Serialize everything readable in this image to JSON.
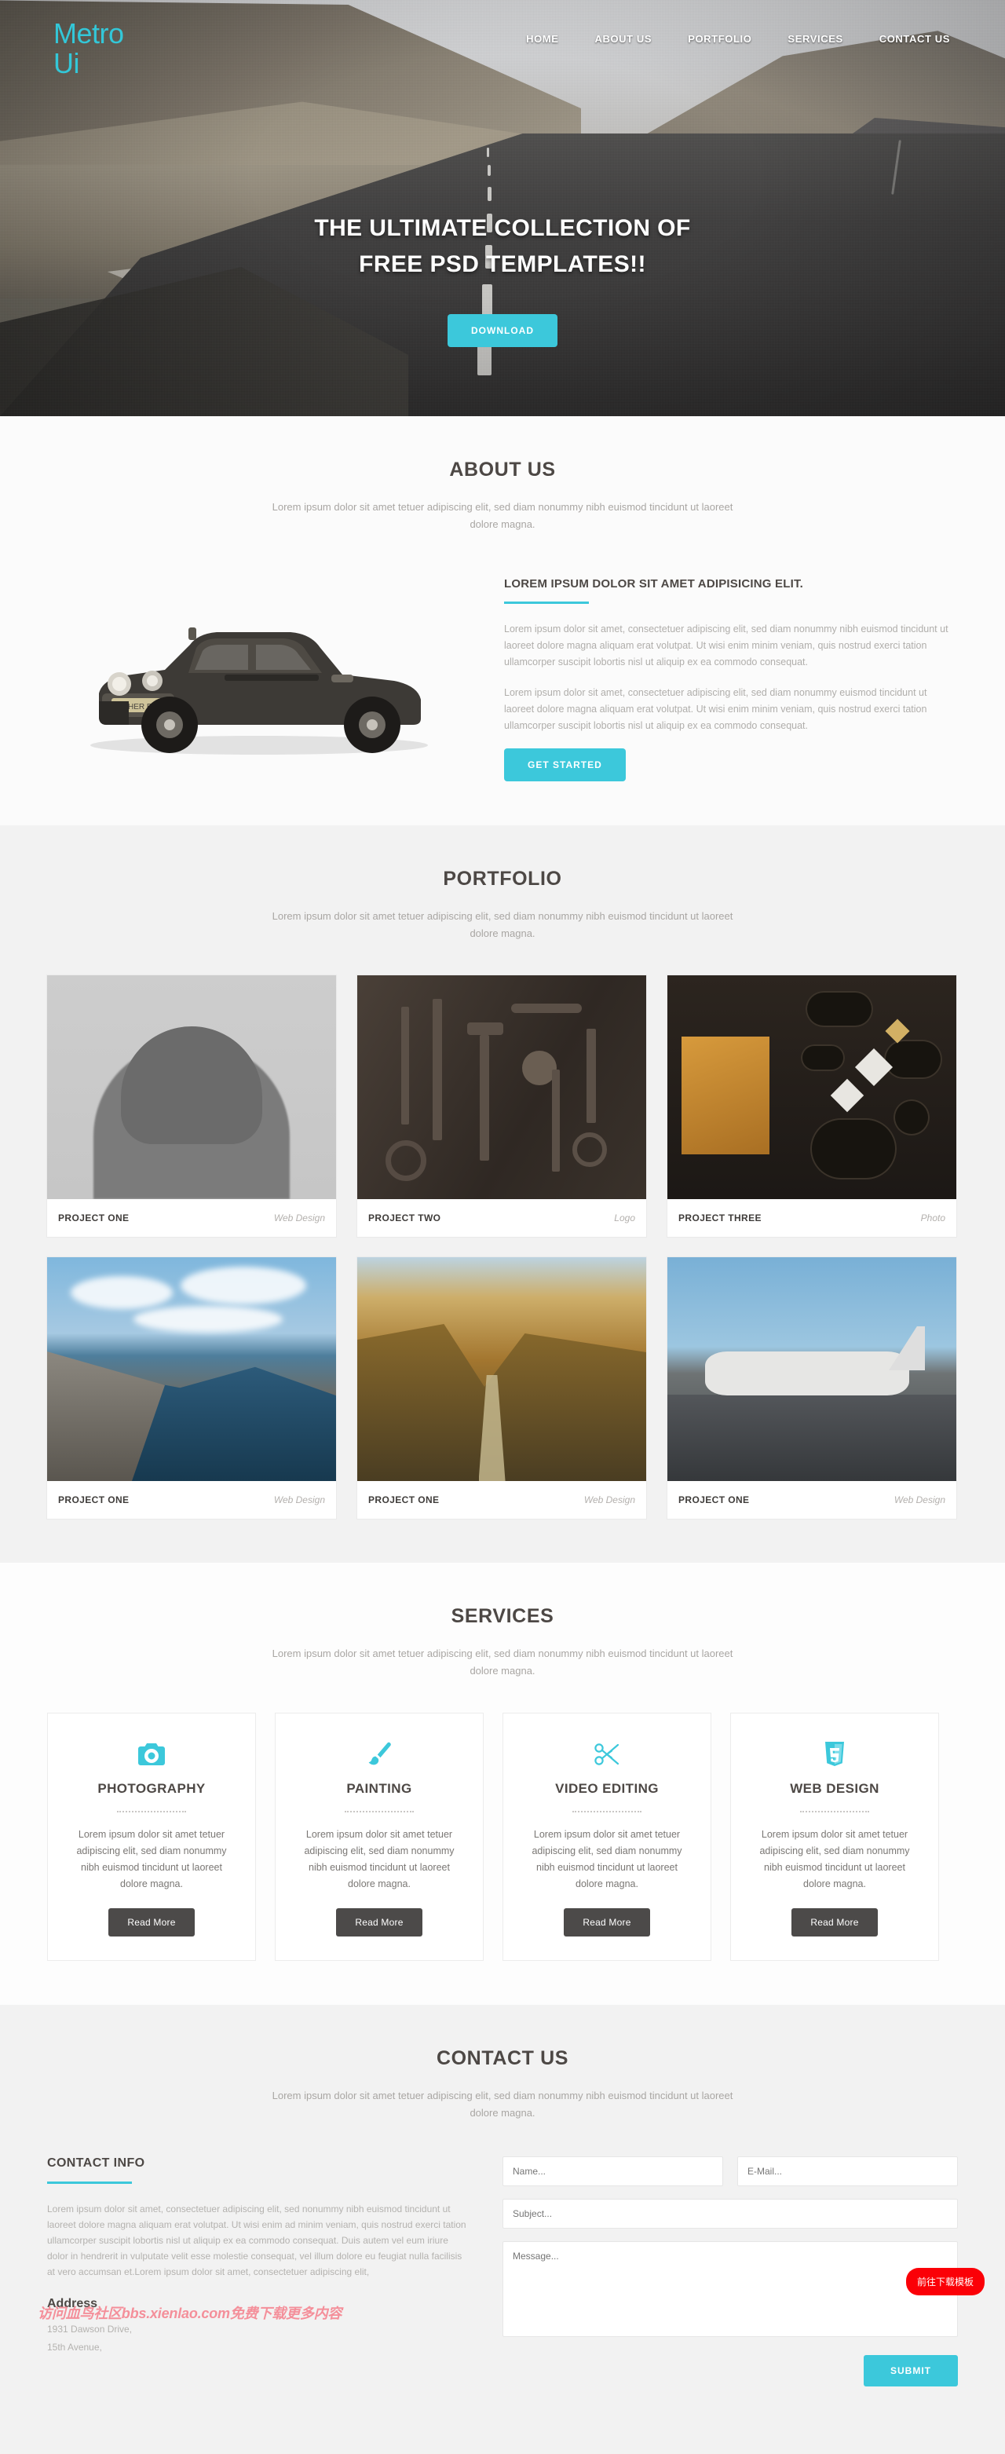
{
  "brand": {
    "name_line1": "Metro",
    "name_line2": "Ui",
    "accent": "#3cc8db"
  },
  "nav": {
    "items": [
      {
        "label": "HOME"
      },
      {
        "label": "ABOUT US"
      },
      {
        "label": "PORTFOLIO"
      },
      {
        "label": "SERVICES"
      },
      {
        "label": "CONTACT US"
      }
    ]
  },
  "hero": {
    "title_line1": "THE ULTIMATE COLLECTION OF",
    "title_line2": "FREE PSD TEMPLATES!!",
    "cta": "DOWNLOAD"
  },
  "about": {
    "title": "ABOUT US",
    "subtitle": "Lorem ipsum dolor sit amet tetuer adipiscing elit, sed diam nonummy nibh euismod tincidunt ut laoreet dolore magna.",
    "heading": "LOREM IPSUM DOLOR SIT AMET ADIPISICING ELIT.",
    "paragraph1": "Lorem ipsum dolor sit amet, consectetuer adipiscing elit, sed diam nonummy nibh euismod tincidunt ut laoreet dolore magna aliquam erat volutpat. Ut wisi enim minim veniam, quis nostrud exerci tation ullamcorper suscipit lobortis nisl ut aliquip ex ea commodo consequat.",
    "paragraph2": "Lorem ipsum dolor sit amet, consectetuer adipiscing elit, sed diam nonummy euismod tincidunt ut laoreet dolore magna aliquam erat volutpat. Ut wisi enim minim veniam, quis nostrud exerci tation ullamcorper suscipit lobortis nisl ut aliquip ex ea commodo consequat.",
    "cta": "GET STARTED",
    "image_alt": "vintage-car-photo"
  },
  "portfolio": {
    "title": "PORTFOLIO",
    "subtitle": "Lorem ipsum dolor sit amet tetuer adipiscing elit, sed diam nonummy nibh euismod tincidunt ut laoreet dolore magna.",
    "items": [
      {
        "name": "PROJECT ONE",
        "category": "Web Design",
        "art": "p1"
      },
      {
        "name": "PROJECT TWO",
        "category": "Logo",
        "art": "p2"
      },
      {
        "name": "PROJECT THREE",
        "category": "Photo",
        "art": "p3"
      },
      {
        "name": "PROJECT ONE",
        "category": "Web Design",
        "art": "p4"
      },
      {
        "name": "PROJECT ONE",
        "category": "Web Design",
        "art": "p5"
      },
      {
        "name": "PROJECT ONE",
        "category": "Web Design",
        "art": "p6"
      }
    ]
  },
  "services": {
    "title": "SERVICES",
    "subtitle": "Lorem ipsum dolor sit amet tetuer adipiscing elit, sed diam nonummy nibh euismod tincidunt ut laoreet dolore magna.",
    "items": [
      {
        "icon": "camera-icon",
        "heading": "PHOTOGRAPHY",
        "body": "Lorem ipsum dolor sit amet tetuer adipiscing elit, sed diam nonummy nibh euismod tincidunt ut laoreet dolore magna.",
        "cta": "Read More"
      },
      {
        "icon": "paintbrush-icon",
        "heading": "PAINTING",
        "body": "Lorem ipsum dolor sit amet tetuer adipiscing elit, sed diam nonummy nibh euismod tincidunt ut laoreet dolore magna.",
        "cta": "Read More"
      },
      {
        "icon": "scissors-icon",
        "heading": "VIDEO EDITING",
        "body": "Lorem ipsum dolor sit amet tetuer adipiscing elit, sed diam nonummy nibh euismod tincidunt ut laoreet dolore magna.",
        "cta": "Read More"
      },
      {
        "icon": "html5-icon",
        "heading": "WEB DESIGN",
        "body": "Lorem ipsum dolor sit amet tetuer adipiscing elit, sed diam nonummy nibh euismod tincidunt ut laoreet dolore magna.",
        "cta": "Read More"
      }
    ]
  },
  "contact": {
    "title": "CONTACT US",
    "subtitle": "Lorem ipsum dolor sit amet tetuer adipiscing elit, sed diam nonummy nibh euismod tincidunt ut laoreet dolore magna.",
    "info_heading": "CONTACT INFO",
    "info_body": "Lorem ipsum dolor sit amet, consectetuer adipiscing elit, sed nonummy nibh euismod tincidunt ut laoreet dolore magna aliquam erat volutpat. Ut wisi enim ad minim veniam, quis nostrud exerci tation ullamcorper suscipit lobortis nisl ut aliquip ex ea commodo consequat. Duis autem vel eum iriure dolor in hendrerit in vulputate velit esse molestie consequat, vel illum dolore eu feugiat nulla facilisis at vero accumsan et.Lorem ipsum dolor sit amet, consectetuer adipiscing elit,",
    "address_heading": "Address",
    "address_line1": "1931 Dawson Drive,",
    "address_line2": "15th Avenue,",
    "form": {
      "name_value": "",
      "name_placeholder": "Name...",
      "email_value": "",
      "email_placeholder": "E-Mail...",
      "subject_value": "",
      "subject_placeholder": "Subject...",
      "message_value": "",
      "message_placeholder": "Message...",
      "submit": "SUBMIT"
    }
  },
  "overlay": {
    "download_badge": "前往下载模板",
    "watermark": "访问血鸟社区bbs.xienlao.com免费下载更多内容"
  }
}
